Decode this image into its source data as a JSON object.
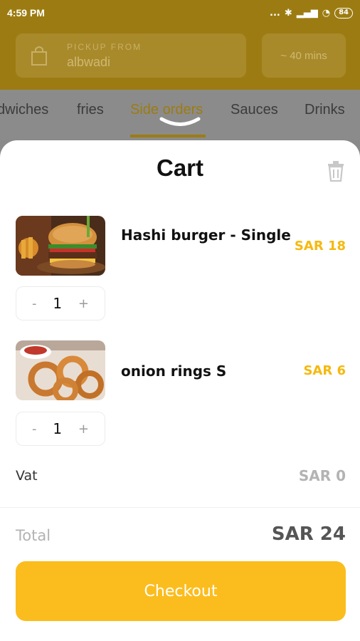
{
  "status_bar": {
    "time": "4:59 PM",
    "signal": "...",
    "battery": "84"
  },
  "header": {
    "pickup_label": "PICKUP FROM",
    "pickup_value": "albwadi",
    "eta": "~ 40 mins"
  },
  "tabs": [
    {
      "label": "dwiches"
    },
    {
      "label": "fries"
    },
    {
      "label": "Side orders"
    },
    {
      "label": "Sauces"
    },
    {
      "label": "Drinks"
    }
  ],
  "cart": {
    "title": "Cart",
    "items": [
      {
        "name": "Hashi burger - Single",
        "price": "SAR 18",
        "quantity": "1"
      },
      {
        "name": "onion rings S",
        "price": "SAR 6",
        "quantity": "1"
      }
    ],
    "qty_minus": "-",
    "qty_plus": "+",
    "vat_label": "Vat",
    "vat_value": "SAR 0",
    "total_label": "Total",
    "total_value": "SAR 24",
    "checkout_label": "Checkout"
  },
  "colors": {
    "accent": "#fbbd1e",
    "price": "#f5b90f",
    "header_dimmed": "#9c7c12"
  }
}
